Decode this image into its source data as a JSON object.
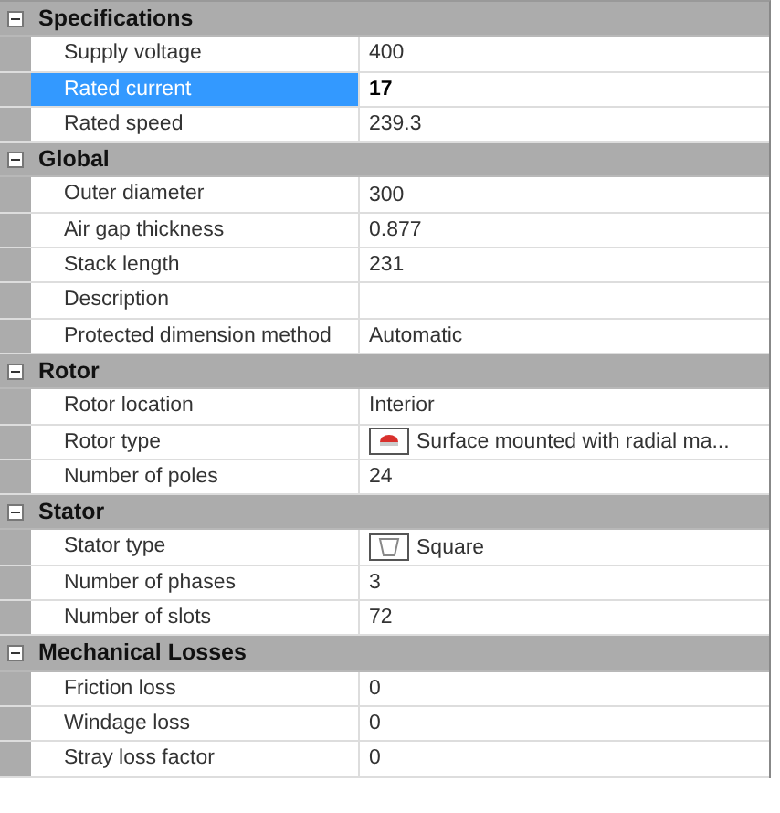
{
  "categories": [
    {
      "title": "Specifications",
      "expanded": true,
      "rows": [
        {
          "label": "Supply voltage",
          "value": "400",
          "selected": false,
          "kind": "text"
        },
        {
          "label": "Rated current",
          "value": "17",
          "selected": true,
          "modified": true,
          "kind": "text"
        },
        {
          "label": "Rated speed",
          "value": "239.3",
          "selected": false,
          "kind": "text"
        }
      ]
    },
    {
      "title": "Global",
      "expanded": true,
      "rows": [
        {
          "label": "Outer diameter",
          "value": "300",
          "selected": false,
          "kind": "text"
        },
        {
          "label": "Air gap thickness",
          "value": "0.877",
          "selected": false,
          "kind": "text"
        },
        {
          "label": "Stack length",
          "value": "231",
          "selected": false,
          "kind": "text"
        },
        {
          "label": "Description",
          "selected": false,
          "kind": "text"
        },
        {
          "label": "Protected dimension method",
          "value": "Automatic",
          "selected": false,
          "kind": "text"
        }
      ]
    },
    {
      "title": "Rotor",
      "expanded": true,
      "rows": [
        {
          "label": "Rotor location",
          "value": "Interior",
          "selected": false,
          "kind": "text"
        },
        {
          "label": "Rotor type",
          "value": "Surface mounted with radial ma...",
          "selected": false,
          "kind": "rotor"
        },
        {
          "label": "Number of poles",
          "value": "24",
          "selected": false,
          "kind": "text"
        }
      ]
    },
    {
      "title": "Stator",
      "expanded": true,
      "rows": [
        {
          "label": "Stator type",
          "value": "Square",
          "selected": false,
          "kind": "stator"
        },
        {
          "label": "Number of phases",
          "value": "3",
          "selected": false,
          "kind": "text"
        },
        {
          "label": "Number of slots",
          "value": "72",
          "selected": false,
          "kind": "text"
        }
      ]
    },
    {
      "title": "Mechanical Losses",
      "expanded": true,
      "rows": [
        {
          "label": "Friction loss",
          "value": "0",
          "selected": false,
          "kind": "text"
        },
        {
          "label": "Windage loss",
          "value": "0",
          "selected": false,
          "kind": "text"
        },
        {
          "label": "Stray loss factor",
          "value": "0",
          "selected": false,
          "kind": "text"
        }
      ]
    }
  ]
}
